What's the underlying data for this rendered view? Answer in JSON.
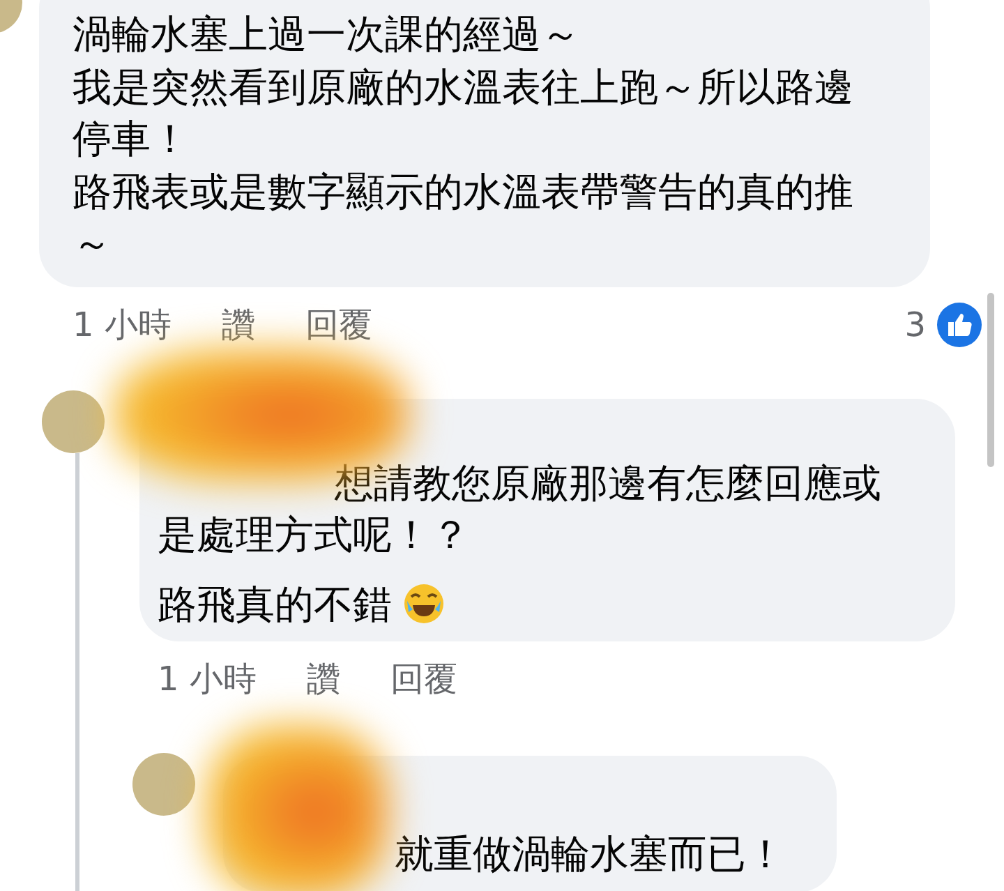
{
  "comment": {
    "paragraphs": [
      "渦輪水塞上過一次課的經過～",
      "我是突然看到原廠的水溫表往上跑～所以路邊停車！",
      "路飛表或是數字顯示的水溫表帶警告的真的推～"
    ],
    "time": "1 小時",
    "like": "讚",
    "reply": "回覆",
    "like_count": "3",
    "replies": [
      {
        "paragraphs": [
          "想請教您原廠那邊有怎麼回應或是處理方式呢！？",
          "路飛真的不錯"
        ],
        "emoji": true,
        "time": "1 小時",
        "like": "讚",
        "reply": "回覆"
      },
      {
        "paragraphs": [
          "就重做渦輪水塞而已！"
        ]
      }
    ]
  }
}
